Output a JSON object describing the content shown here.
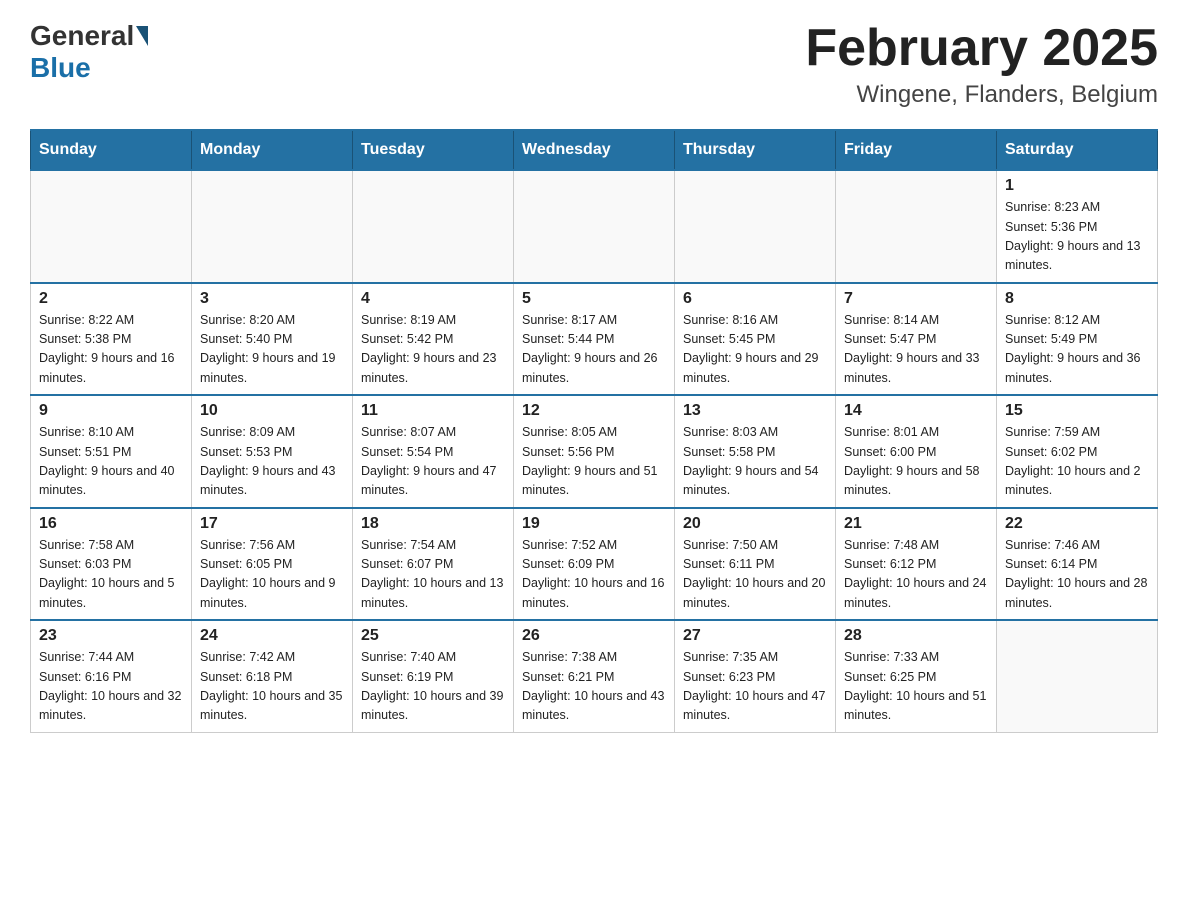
{
  "header": {
    "logo": {
      "general": "General",
      "blue": "Blue"
    },
    "title": "February 2025",
    "location": "Wingene, Flanders, Belgium"
  },
  "weekdays": [
    "Sunday",
    "Monday",
    "Tuesday",
    "Wednesday",
    "Thursday",
    "Friday",
    "Saturday"
  ],
  "weeks": [
    [
      {
        "day": "",
        "info": ""
      },
      {
        "day": "",
        "info": ""
      },
      {
        "day": "",
        "info": ""
      },
      {
        "day": "",
        "info": ""
      },
      {
        "day": "",
        "info": ""
      },
      {
        "day": "",
        "info": ""
      },
      {
        "day": "1",
        "info": "Sunrise: 8:23 AM\nSunset: 5:36 PM\nDaylight: 9 hours and 13 minutes."
      }
    ],
    [
      {
        "day": "2",
        "info": "Sunrise: 8:22 AM\nSunset: 5:38 PM\nDaylight: 9 hours and 16 minutes."
      },
      {
        "day": "3",
        "info": "Sunrise: 8:20 AM\nSunset: 5:40 PM\nDaylight: 9 hours and 19 minutes."
      },
      {
        "day": "4",
        "info": "Sunrise: 8:19 AM\nSunset: 5:42 PM\nDaylight: 9 hours and 23 minutes."
      },
      {
        "day": "5",
        "info": "Sunrise: 8:17 AM\nSunset: 5:44 PM\nDaylight: 9 hours and 26 minutes."
      },
      {
        "day": "6",
        "info": "Sunrise: 8:16 AM\nSunset: 5:45 PM\nDaylight: 9 hours and 29 minutes."
      },
      {
        "day": "7",
        "info": "Sunrise: 8:14 AM\nSunset: 5:47 PM\nDaylight: 9 hours and 33 minutes."
      },
      {
        "day": "8",
        "info": "Sunrise: 8:12 AM\nSunset: 5:49 PM\nDaylight: 9 hours and 36 minutes."
      }
    ],
    [
      {
        "day": "9",
        "info": "Sunrise: 8:10 AM\nSunset: 5:51 PM\nDaylight: 9 hours and 40 minutes."
      },
      {
        "day": "10",
        "info": "Sunrise: 8:09 AM\nSunset: 5:53 PM\nDaylight: 9 hours and 43 minutes."
      },
      {
        "day": "11",
        "info": "Sunrise: 8:07 AM\nSunset: 5:54 PM\nDaylight: 9 hours and 47 minutes."
      },
      {
        "day": "12",
        "info": "Sunrise: 8:05 AM\nSunset: 5:56 PM\nDaylight: 9 hours and 51 minutes."
      },
      {
        "day": "13",
        "info": "Sunrise: 8:03 AM\nSunset: 5:58 PM\nDaylight: 9 hours and 54 minutes."
      },
      {
        "day": "14",
        "info": "Sunrise: 8:01 AM\nSunset: 6:00 PM\nDaylight: 9 hours and 58 minutes."
      },
      {
        "day": "15",
        "info": "Sunrise: 7:59 AM\nSunset: 6:02 PM\nDaylight: 10 hours and 2 minutes."
      }
    ],
    [
      {
        "day": "16",
        "info": "Sunrise: 7:58 AM\nSunset: 6:03 PM\nDaylight: 10 hours and 5 minutes."
      },
      {
        "day": "17",
        "info": "Sunrise: 7:56 AM\nSunset: 6:05 PM\nDaylight: 10 hours and 9 minutes."
      },
      {
        "day": "18",
        "info": "Sunrise: 7:54 AM\nSunset: 6:07 PM\nDaylight: 10 hours and 13 minutes."
      },
      {
        "day": "19",
        "info": "Sunrise: 7:52 AM\nSunset: 6:09 PM\nDaylight: 10 hours and 16 minutes."
      },
      {
        "day": "20",
        "info": "Sunrise: 7:50 AM\nSunset: 6:11 PM\nDaylight: 10 hours and 20 minutes."
      },
      {
        "day": "21",
        "info": "Sunrise: 7:48 AM\nSunset: 6:12 PM\nDaylight: 10 hours and 24 minutes."
      },
      {
        "day": "22",
        "info": "Sunrise: 7:46 AM\nSunset: 6:14 PM\nDaylight: 10 hours and 28 minutes."
      }
    ],
    [
      {
        "day": "23",
        "info": "Sunrise: 7:44 AM\nSunset: 6:16 PM\nDaylight: 10 hours and 32 minutes."
      },
      {
        "day": "24",
        "info": "Sunrise: 7:42 AM\nSunset: 6:18 PM\nDaylight: 10 hours and 35 minutes."
      },
      {
        "day": "25",
        "info": "Sunrise: 7:40 AM\nSunset: 6:19 PM\nDaylight: 10 hours and 39 minutes."
      },
      {
        "day": "26",
        "info": "Sunrise: 7:38 AM\nSunset: 6:21 PM\nDaylight: 10 hours and 43 minutes."
      },
      {
        "day": "27",
        "info": "Sunrise: 7:35 AM\nSunset: 6:23 PM\nDaylight: 10 hours and 47 minutes."
      },
      {
        "day": "28",
        "info": "Sunrise: 7:33 AM\nSunset: 6:25 PM\nDaylight: 10 hours and 51 minutes."
      },
      {
        "day": "",
        "info": ""
      }
    ]
  ]
}
